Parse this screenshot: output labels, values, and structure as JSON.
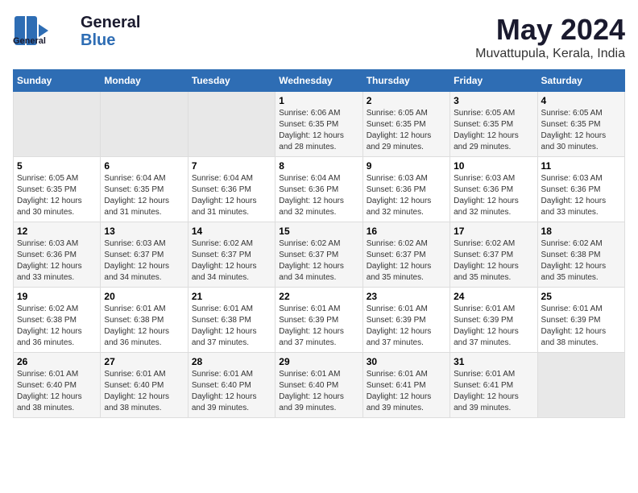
{
  "logo": {
    "line1": "General",
    "line2": "Blue"
  },
  "title": "May 2024",
  "subtitle": "Muvattupula, Kerala, India",
  "days_of_week": [
    "Sunday",
    "Monday",
    "Tuesday",
    "Wednesday",
    "Thursday",
    "Friday",
    "Saturday"
  ],
  "weeks": [
    [
      {
        "day": "",
        "info": ""
      },
      {
        "day": "",
        "info": ""
      },
      {
        "day": "",
        "info": ""
      },
      {
        "day": "1",
        "info": "Sunrise: 6:06 AM\nSunset: 6:35 PM\nDaylight: 12 hours\nand 28 minutes."
      },
      {
        "day": "2",
        "info": "Sunrise: 6:05 AM\nSunset: 6:35 PM\nDaylight: 12 hours\nand 29 minutes."
      },
      {
        "day": "3",
        "info": "Sunrise: 6:05 AM\nSunset: 6:35 PM\nDaylight: 12 hours\nand 29 minutes."
      },
      {
        "day": "4",
        "info": "Sunrise: 6:05 AM\nSunset: 6:35 PM\nDaylight: 12 hours\nand 30 minutes."
      }
    ],
    [
      {
        "day": "5",
        "info": "Sunrise: 6:05 AM\nSunset: 6:35 PM\nDaylight: 12 hours\nand 30 minutes."
      },
      {
        "day": "6",
        "info": "Sunrise: 6:04 AM\nSunset: 6:35 PM\nDaylight: 12 hours\nand 31 minutes."
      },
      {
        "day": "7",
        "info": "Sunrise: 6:04 AM\nSunset: 6:36 PM\nDaylight: 12 hours\nand 31 minutes."
      },
      {
        "day": "8",
        "info": "Sunrise: 6:04 AM\nSunset: 6:36 PM\nDaylight: 12 hours\nand 32 minutes."
      },
      {
        "day": "9",
        "info": "Sunrise: 6:03 AM\nSunset: 6:36 PM\nDaylight: 12 hours\nand 32 minutes."
      },
      {
        "day": "10",
        "info": "Sunrise: 6:03 AM\nSunset: 6:36 PM\nDaylight: 12 hours\nand 32 minutes."
      },
      {
        "day": "11",
        "info": "Sunrise: 6:03 AM\nSunset: 6:36 PM\nDaylight: 12 hours\nand 33 minutes."
      }
    ],
    [
      {
        "day": "12",
        "info": "Sunrise: 6:03 AM\nSunset: 6:36 PM\nDaylight: 12 hours\nand 33 minutes."
      },
      {
        "day": "13",
        "info": "Sunrise: 6:03 AM\nSunset: 6:37 PM\nDaylight: 12 hours\nand 34 minutes."
      },
      {
        "day": "14",
        "info": "Sunrise: 6:02 AM\nSunset: 6:37 PM\nDaylight: 12 hours\nand 34 minutes."
      },
      {
        "day": "15",
        "info": "Sunrise: 6:02 AM\nSunset: 6:37 PM\nDaylight: 12 hours\nand 34 minutes."
      },
      {
        "day": "16",
        "info": "Sunrise: 6:02 AM\nSunset: 6:37 PM\nDaylight: 12 hours\nand 35 minutes."
      },
      {
        "day": "17",
        "info": "Sunrise: 6:02 AM\nSunset: 6:37 PM\nDaylight: 12 hours\nand 35 minutes."
      },
      {
        "day": "18",
        "info": "Sunrise: 6:02 AM\nSunset: 6:38 PM\nDaylight: 12 hours\nand 35 minutes."
      }
    ],
    [
      {
        "day": "19",
        "info": "Sunrise: 6:02 AM\nSunset: 6:38 PM\nDaylight: 12 hours\nand 36 minutes."
      },
      {
        "day": "20",
        "info": "Sunrise: 6:01 AM\nSunset: 6:38 PM\nDaylight: 12 hours\nand 36 minutes."
      },
      {
        "day": "21",
        "info": "Sunrise: 6:01 AM\nSunset: 6:38 PM\nDaylight: 12 hours\nand 37 minutes."
      },
      {
        "day": "22",
        "info": "Sunrise: 6:01 AM\nSunset: 6:39 PM\nDaylight: 12 hours\nand 37 minutes."
      },
      {
        "day": "23",
        "info": "Sunrise: 6:01 AM\nSunset: 6:39 PM\nDaylight: 12 hours\nand 37 minutes."
      },
      {
        "day": "24",
        "info": "Sunrise: 6:01 AM\nSunset: 6:39 PM\nDaylight: 12 hours\nand 37 minutes."
      },
      {
        "day": "25",
        "info": "Sunrise: 6:01 AM\nSunset: 6:39 PM\nDaylight: 12 hours\nand 38 minutes."
      }
    ],
    [
      {
        "day": "26",
        "info": "Sunrise: 6:01 AM\nSunset: 6:40 PM\nDaylight: 12 hours\nand 38 minutes."
      },
      {
        "day": "27",
        "info": "Sunrise: 6:01 AM\nSunset: 6:40 PM\nDaylight: 12 hours\nand 38 minutes."
      },
      {
        "day": "28",
        "info": "Sunrise: 6:01 AM\nSunset: 6:40 PM\nDaylight: 12 hours\nand 39 minutes."
      },
      {
        "day": "29",
        "info": "Sunrise: 6:01 AM\nSunset: 6:40 PM\nDaylight: 12 hours\nand 39 minutes."
      },
      {
        "day": "30",
        "info": "Sunrise: 6:01 AM\nSunset: 6:41 PM\nDaylight: 12 hours\nand 39 minutes."
      },
      {
        "day": "31",
        "info": "Sunrise: 6:01 AM\nSunset: 6:41 PM\nDaylight: 12 hours\nand 39 minutes."
      },
      {
        "day": "",
        "info": ""
      }
    ]
  ]
}
